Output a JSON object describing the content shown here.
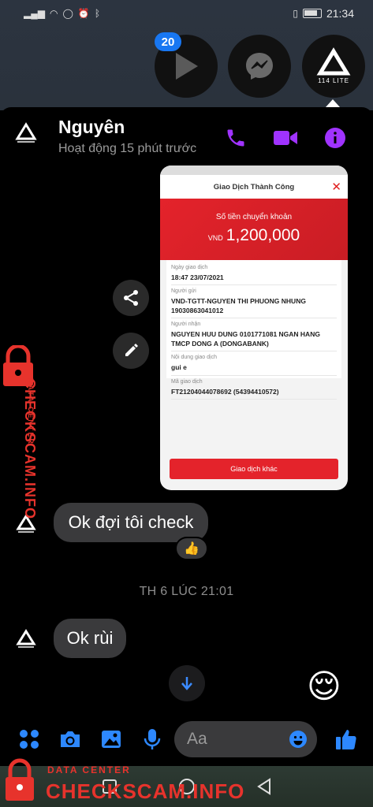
{
  "status_bar": {
    "time": "21:34"
  },
  "chat_heads": {
    "badge_count": "20",
    "logo_caption": "114 LITE"
  },
  "header": {
    "name": "Nguyên",
    "status": "Hoạt động 15 phút trước",
    "call_color": "#a033ff"
  },
  "receipt": {
    "title": "Giao Dịch Thành Công",
    "amount_label": "Số tiền chuyển khoản",
    "currency": "VND",
    "amount": "1,200,000",
    "fields": [
      {
        "label": "Ngày giao dịch",
        "value": "18:47 23/07/2021"
      },
      {
        "label": "Người gửi",
        "value": "VND-TGTT-NGUYEN THI PHUONG NHUNG 19030863041012"
      },
      {
        "label": "Người nhận",
        "value": "NGUYEN HUU DUNG 0101771081 NGAN HANG TMCP DONG A (DONGABANK)"
      },
      {
        "label": "Nội dung giao dịch",
        "value": "gui e"
      },
      {
        "label": "Mã giao dịch",
        "value": "FT21204044078692 (54394410572)"
      }
    ],
    "button": "Giao dịch khác"
  },
  "messages": {
    "msg1": "Ok đợi tôi check",
    "reaction": "👍",
    "timestamp": "TH 6 LÚC 21:01",
    "msg2": "Ok rùi",
    "sticker": "😌"
  },
  "composer": {
    "placeholder": "Aa"
  },
  "watermark": {
    "side_text": "CHECKSCAM.INFO",
    "side_caption": "DATA CENTER",
    "bottom_caption": "DATA CENTER",
    "bottom_text": "CHECKSCAM.INFO",
    "color": "#e7332c"
  }
}
